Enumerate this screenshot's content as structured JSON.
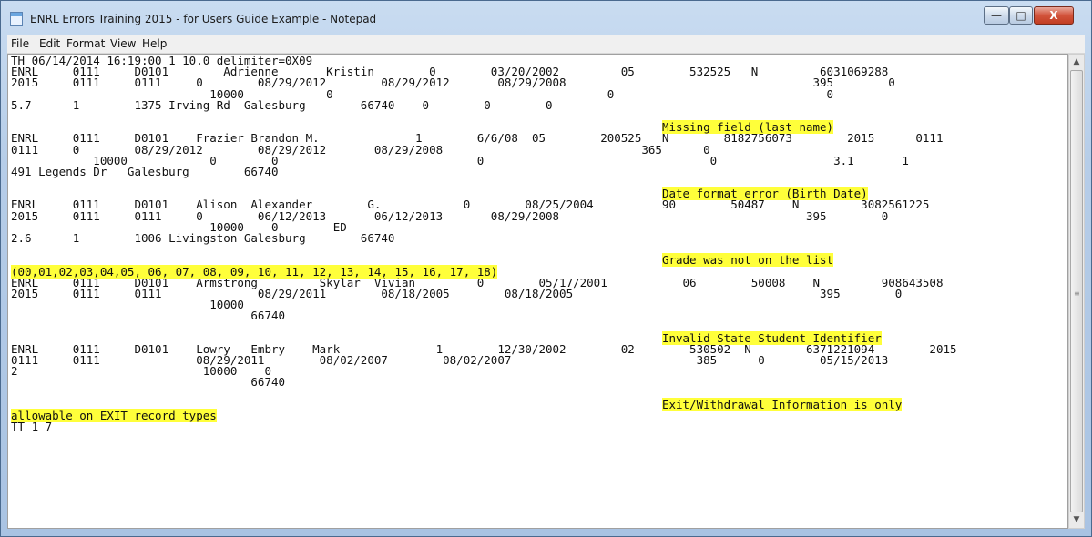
{
  "window": {
    "title": "ENRL Errors Training 2015 - for Users Guide Example - Notepad",
    "minimize_glyph": "—",
    "maximize_glyph": "□",
    "close_glyph": "X"
  },
  "menu": [
    "File",
    "Edit",
    "Format",
    "View",
    "Help"
  ],
  "editor": {
    "lines": [
      "TH 06/14/2014 16:19:00 1 10.0 delimiter=0X09",
      "ENRL     0111     D0101        Adrienne       Kristin        0        03/20/2002         05        532525   N         6031069288",
      "2015     0111     0111     0        08/29/2012        08/29/2012       08/29/2008                                    395        0",
      "                             10000            0                                        0                               0",
      "5.7      1        1375 Irving Rd  Galesburg        66740    0        0        0",
      "",
      "                                                                                               Missing field (last name)",
      "ENRL     0111     D0101    Frazier Brandon M.              1        6/6/08  05        200525   N        8182756073        2015      0111",
      "0111     0        08/29/2012        08/29/2012       08/29/2008                             365      0",
      "            10000            0        0                             0                                 0                 3.1       1",
      "491 Legends Dr   Galesburg        66740",
      "",
      "                                                                                               Date format error (Birth Date)",
      "ENRL     0111     D0101    Alison  Alexander        G.            0        08/25/2004          90        50487    N         3082561225",
      "2015     0111     0111     0        06/12/2013       06/12/2013       08/29/2008                                    395        0",
      "                             10000    0        ED",
      "2.6      1        1006 Livingston Galesburg        66740",
      "",
      "                                                                                               Grade was not on the list",
      "(00,01,02,03,04,05, 06, 07, 08, 09, 10, 11, 12, 13, 14, 15, 16, 17, 18)",
      "ENRL     0111     D0101    Armstrong         Skylar  Vivian         0        05/17/2001           06        50008    N         908643508",
      "2015     0111     0111              08/29/2011        08/18/2005        08/18/2005                                    395        0",
      "                             10000",
      "                                   66740",
      "",
      "                                                                                               Invalid State Student Identifier",
      "ENRL     0111     D0101    Lowry   Embry    Mark              1        12/30/2002        02        530502  N        6371221094        2015",
      "0111     0111              08/29/2011        08/02/2007        08/02/2007                           385      0        05/15/2013",
      "2                           10000    0",
      "                                   66740",
      "",
      "                                                                                               Exit/Withdrawal Information is only",
      "allowable on EXIT record types",
      "TT 1 7"
    ],
    "highlighted_lines": [
      6,
      12,
      18,
      19,
      25,
      31,
      32
    ]
  },
  "scrollbar": {
    "up_glyph": "▲",
    "down_glyph": "▼",
    "grip_glyph": "≡"
  }
}
